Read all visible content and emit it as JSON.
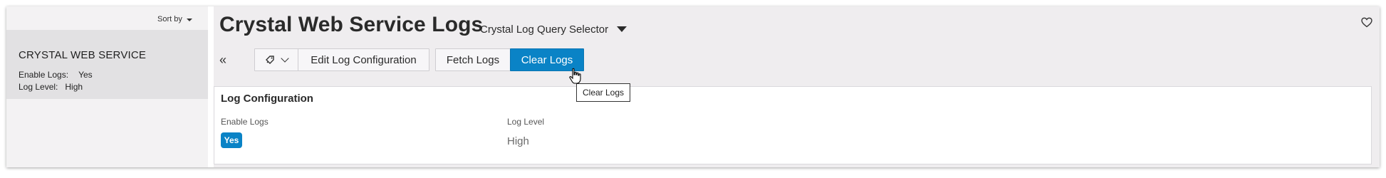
{
  "sort": {
    "label": "Sort by"
  },
  "record": {
    "title": "CRYSTAL WEB SERVICE",
    "enable_logs_label": "Enable Logs:",
    "enable_logs_value": "Yes",
    "log_level_label": "Log Level:",
    "log_level_value": "High"
  },
  "header": {
    "title": "Crystal Web Service Logs",
    "query_selector": "Crystal Log Query Selector"
  },
  "toolbar": {
    "edit_label": "Edit Log Configuration",
    "fetch_label": "Fetch Logs",
    "clear_label": "Clear Logs"
  },
  "tooltip": {
    "text": "Clear Logs"
  },
  "card": {
    "title": "Log Configuration",
    "enable_logs_label": "Enable Logs",
    "enable_logs_value": "Yes",
    "log_level_label": "Log Level",
    "log_level_value": "High"
  },
  "colors": {
    "accent": "#0a83c6",
    "panel_bg": "#efedef"
  },
  "icons": [
    "chevron-double-left-icon",
    "tag-icon",
    "chevron-down-icon",
    "heart-icon",
    "pointer-cursor-icon"
  ]
}
